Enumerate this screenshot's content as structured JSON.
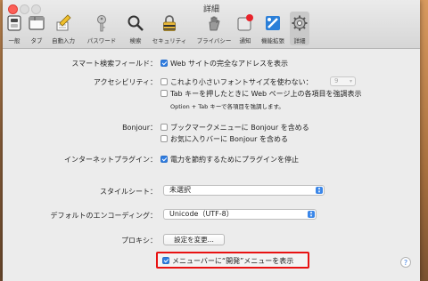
{
  "window": {
    "title": "詳細"
  },
  "toolbar": {
    "tabs": [
      {
        "label": "一般",
        "icon": "switch-icon"
      },
      {
        "label": "タブ",
        "icon": "tabs-icon"
      },
      {
        "label": "自動入力",
        "icon": "pencil-icon"
      },
      {
        "label": "パスワード",
        "icon": "key-icon"
      },
      {
        "label": "検索",
        "icon": "search-icon"
      },
      {
        "label": "セキュリティ",
        "icon": "lock-icon"
      },
      {
        "label": "プライバシー",
        "icon": "hand-icon"
      },
      {
        "label": "通知",
        "icon": "notification-icon"
      },
      {
        "label": "機能拡張",
        "icon": "puzzle-icon"
      },
      {
        "label": "詳細",
        "icon": "gear-icon",
        "active": true
      }
    ]
  },
  "settings": {
    "smart_search": {
      "label": "スマート検索フィールド：",
      "option": "Web サイトの完全なアドレスを表示",
      "checked": true
    },
    "accessibility": {
      "label": "アクセシビリティ：",
      "font_option": "これより小さいフォントサイズを使わない：",
      "font_checked": false,
      "font_size": "9",
      "tab_option": "Tab キーを押したときに Web ページ上の各項目を強調表示",
      "tab_checked": false,
      "tab_hint": "Option + Tab キーで各項目を強調します。"
    },
    "bonjour": {
      "label": "Bonjour：",
      "bookmarks_option": "ブックマークメニューに Bonjour を含める",
      "bookmarks_checked": false,
      "favorites_option": "お気に入りバーに Bonjour を含める",
      "favorites_checked": false
    },
    "plugins": {
      "label": "インターネットプラグイン：",
      "option": "電力を節約するためにプラグインを停止",
      "checked": true
    },
    "stylesheet": {
      "label": "スタイルシート：",
      "value": "未選択"
    },
    "encoding": {
      "label": "デフォルトのエンコーディング：",
      "value": "Unicode（UTF-8）"
    },
    "proxy": {
      "label": "プロキシ：",
      "button": "設定を変更..."
    },
    "develop_menu": {
      "option": "メニューバーに“開発”メニューを表示",
      "checked": true
    }
  },
  "help": {
    "label": "?"
  },
  "colors": {
    "accent": "#2f7de1",
    "highlight": "#e81212"
  }
}
